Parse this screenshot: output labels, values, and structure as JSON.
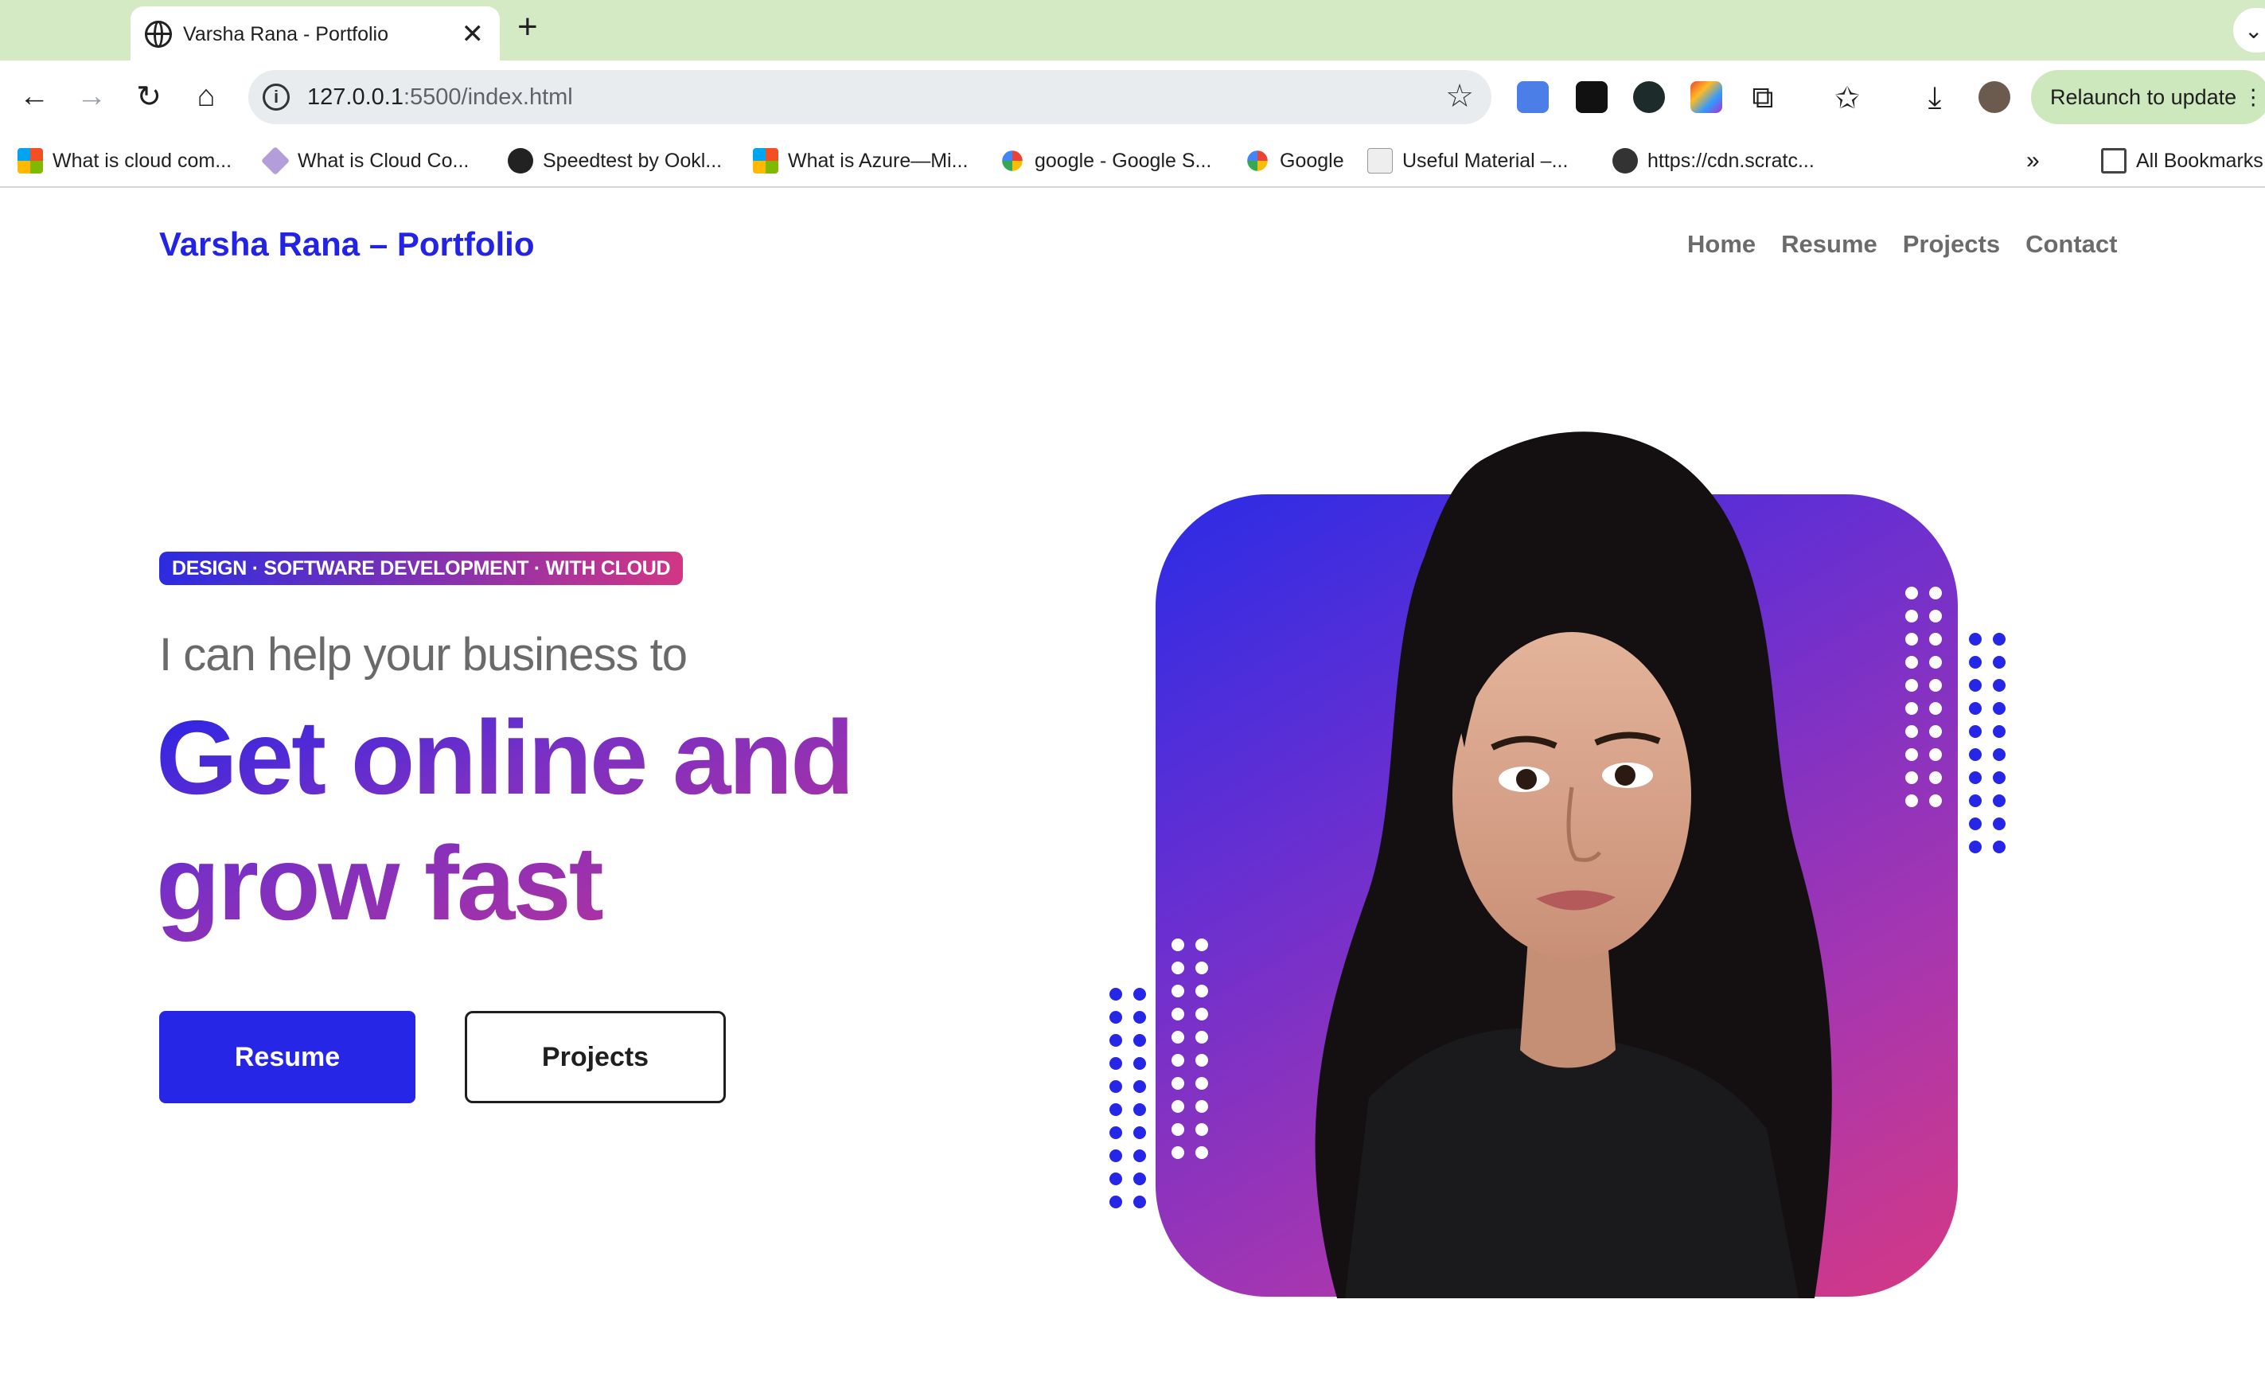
{
  "browser": {
    "tab_title": "Varsha Rana - Portfolio",
    "url_host": "127.0.0.1",
    "url_rest": ":5500/index.html",
    "relaunch_label": "Relaunch to update",
    "bookmarks": [
      {
        "label": "What is cloud com...",
        "icon": "microsoft-icon"
      },
      {
        "label": "What is Cloud Co...",
        "icon": "cube-icon"
      },
      {
        "label": "Speedtest by Ookl...",
        "icon": "speedtest-icon"
      },
      {
        "label": "What is Azure—Mi...",
        "icon": "microsoft-icon"
      },
      {
        "label": "google - Google S...",
        "icon": "google-icon"
      },
      {
        "label": "Google",
        "icon": "google-icon"
      },
      {
        "label": "Useful Material –...",
        "icon": "sir-icon"
      },
      {
        "label": "https://cdn.scratc...",
        "icon": "globe-icon"
      }
    ],
    "all_bookmarks_label": "All Bookmarks"
  },
  "site": {
    "brand": "Varsha Rana – Portfolio",
    "nav": [
      "Home",
      "Resume",
      "Projects",
      "Contact"
    ],
    "pill": "DESIGN · SOFTWARE DEVELOPMENT · WITH CLOUD",
    "lead": "I can help your business to",
    "headline_line1": "Get online and",
    "headline_line2": "grow fast",
    "btn_resume": "Resume",
    "btn_projects": "Projects"
  },
  "colors": {
    "accent_blue": "#2626e6",
    "accent_pink": "#d53984",
    "tabstrip": "#d3eac5"
  }
}
